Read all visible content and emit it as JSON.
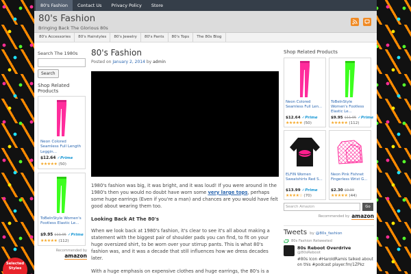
{
  "topnav": {
    "items": [
      "80's Fashion",
      "Contact Us",
      "Privacy Policy",
      "Store"
    ]
  },
  "header": {
    "title": "80's Fashion",
    "tagline": "Bringing Back The Glorious 80s"
  },
  "catnav": {
    "items": [
      "80's Accessories",
      "80's Hairstyles",
      "80's Jewelry",
      "80's Pants",
      "80's Tops",
      "The 80s Blog"
    ]
  },
  "left": {
    "search_title": "Search The 1980s",
    "search_button": "Search",
    "products_title": "Shop Related Products",
    "products": [
      {
        "title": "Neon Colored Seamless Full Length Leggin...",
        "price": "$12.64",
        "prime": "✓Prime",
        "stars": "★★★★★",
        "reviews": "(50)"
      },
      {
        "title": "ToBeInStyle Women's Footless Elastic Le...",
        "price": "$9.95",
        "old_price": "$11.95",
        "prime": "✓Prime",
        "stars": "★★★★★",
        "reviews": "(112)"
      }
    ],
    "recommended": "Recommended by",
    "amazon": "amazon"
  },
  "post": {
    "title": "80's Fashion",
    "posted_on": "Posted on",
    "date": "January 2, 2014",
    "by": "by",
    "author": "admin",
    "p1_before": "1980's fashion was big, it was bright, and it was loud! If you were around in the 1980's then you would no doubt have worn some ",
    "p1_link": "very large tops",
    "p1_after": ", perhaps some huge earrings (Even if you're a man) and chances are you would have felt good about wearing them too.",
    "h3": "Looking Back At The 80's",
    "p2": "When we look back at 1980's fashion, it's clear to see it's all about making a statement with the biggest pair of shoulder pads you can find, to fit on your huge oversized shirt, to be worn over your stirrup pants. This is what 80's fashion was, and it was a decade that still influences how we dress decades later.",
    "p3": "With a huge emphasis on expensive clothes and huge earrings, the 80's is a"
  },
  "right": {
    "products_title": "Shop Related Products",
    "products": [
      {
        "title": "Neon Colored Seamless Full Len...",
        "price": "$12.64",
        "prime": "✓Prime",
        "stars": "★★★★★",
        "reviews": "(50)"
      },
      {
        "title": "ToBeInStyle Women's Footless Elastic Le...",
        "price": "$9.95",
        "old_price": "$11.95",
        "prime": "✓Prime",
        "stars": "★★★★★",
        "reviews": "(112)"
      },
      {
        "title": "ELFIN Women Sweatshirts Red S...",
        "price": "$13.99",
        "prime": "✓Prime",
        "stars": "★★★★☆",
        "reviews": "(70)"
      },
      {
        "title": "Neon Pink Fishnet Fingerless Wrist G...",
        "price": "$2.30",
        "old_price": "$9.99",
        "stars": "★★★★★",
        "reviews": "(44)"
      }
    ],
    "search_placeholder": "Search Amazon",
    "search_go": "Go",
    "recommended": "Recommended by",
    "amazon": "amazon",
    "tweets_title": "Tweets",
    "tweets_by": "by",
    "tweets_handle": "@80s_fashion",
    "retweet_label": "80s Fashion Retweeted",
    "tweet_user": "80s Reboot Overdrive",
    "tweet_handle": "@80sReboot",
    "tweet_text": "#80s Icon #HaroldRamis talked about on this #podcast player.fm/1ZPkz"
  },
  "promo": {
    "text": "Selected Styles"
  }
}
